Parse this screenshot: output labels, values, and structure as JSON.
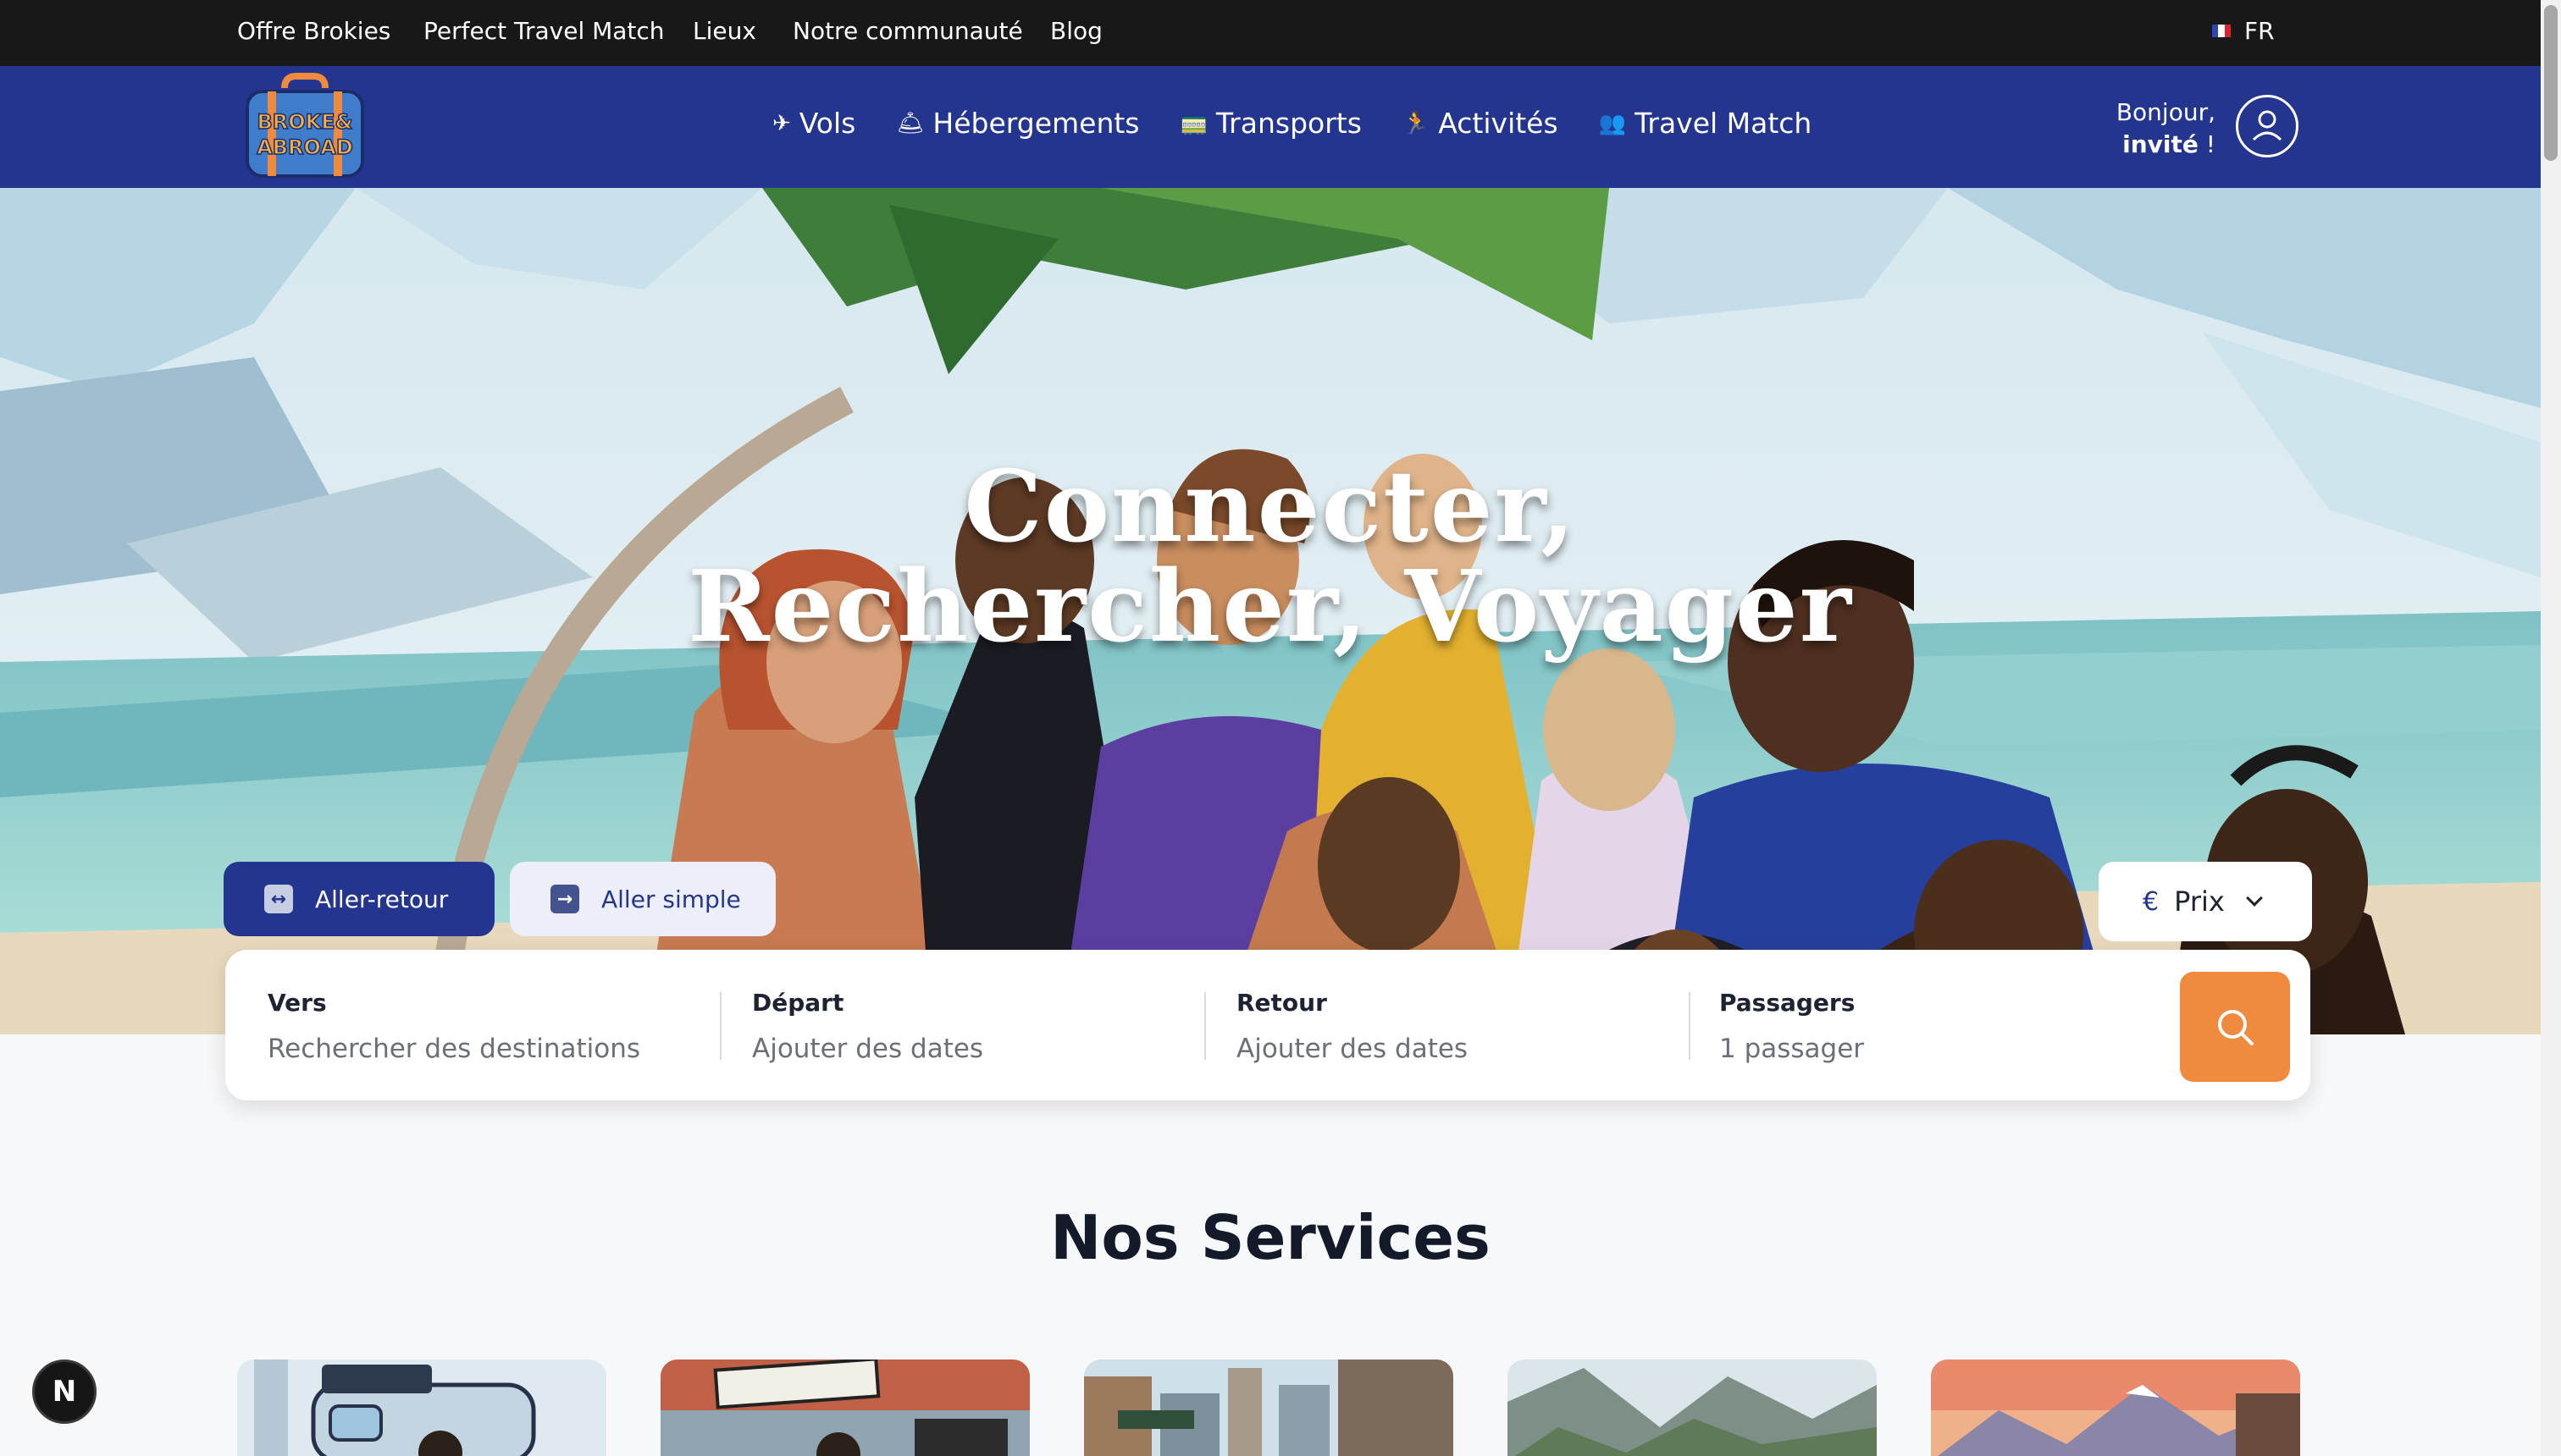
{
  "topbar": {
    "links": [
      "Offre Brokies",
      "Perfect Travel Match",
      "Lieux",
      "Notre communauté",
      "Blog"
    ],
    "language": "FR"
  },
  "nav": {
    "logo_text_line1": "BROKE&",
    "logo_text_line2": "ABROAD",
    "items": [
      {
        "icon": "airplane-icon",
        "glyph": "✈",
        "label": "Vols"
      },
      {
        "icon": "bell-icon",
        "glyph": "🛎",
        "label": "Hébergements"
      },
      {
        "icon": "train-icon",
        "glyph": "🚃",
        "label": "Transports"
      },
      {
        "icon": "runner-icon",
        "glyph": "🏃",
        "label": "Activités"
      },
      {
        "icon": "people-icon",
        "glyph": "👥",
        "label": "Travel Match"
      }
    ],
    "greeting_line1": "Bonjour,",
    "greeting_name": "invité",
    "greeting_suffix": " !"
  },
  "hero": {
    "title_line1": "Connecter,",
    "title_line2": "Rechercher, Voyager"
  },
  "trip": {
    "round_trip": "Aller-retour",
    "one_way": "Aller simple",
    "selected": "Aller-retour"
  },
  "price": {
    "currency": "€",
    "label": "Prix"
  },
  "search": {
    "to_label": "Vers",
    "to_placeholder": "Rechercher des destinations",
    "depart_label": "Départ",
    "depart_placeholder": "Ajouter des dates",
    "return_label": "Retour",
    "return_placeholder": "Ajouter des dates",
    "passengers_label": "Passagers",
    "passengers_value": "1 passager"
  },
  "services": {
    "title": "Nos Services"
  },
  "badge": "N",
  "colors": {
    "nav_bg": "#23358f",
    "topbar_bg": "#181818",
    "accent": "#f08a3e",
    "page_bg": "#f7f8fa"
  }
}
